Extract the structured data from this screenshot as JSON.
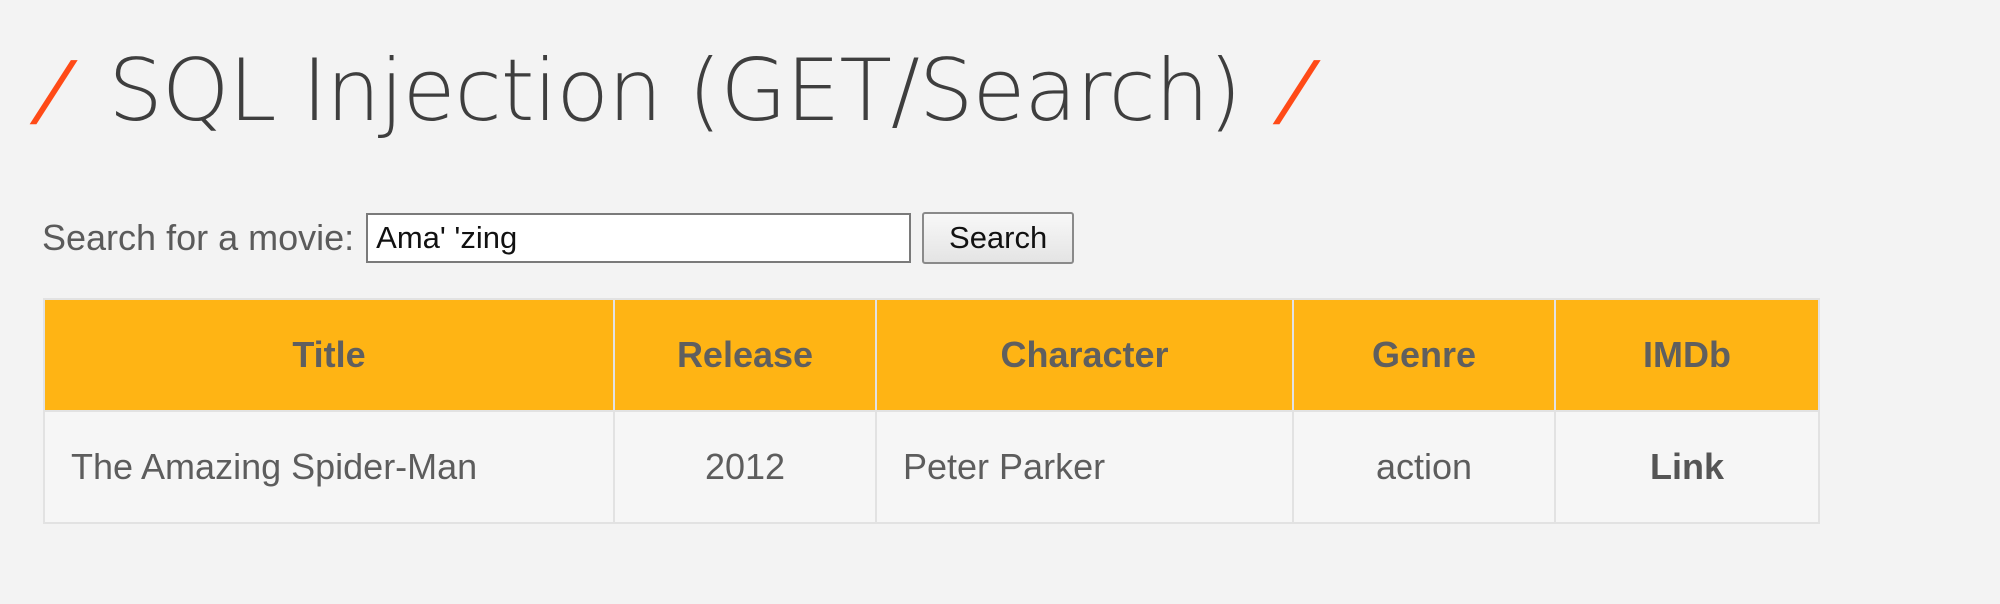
{
  "header": {
    "slash_left": "/",
    "title": "SQL Injection (GET/Search)",
    "slash_right": "/"
  },
  "search": {
    "label": "Search for a movie:",
    "value": "Ama' 'zing",
    "button_label": "Search"
  },
  "table": {
    "headers": {
      "title": "Title",
      "release": "Release",
      "character": "Character",
      "genre": "Genre",
      "imdb": "IMDb"
    },
    "rows": [
      {
        "title": "The Amazing Spider-Man",
        "release": "2012",
        "character": "Peter Parker",
        "genre": "action",
        "imdb": "Link"
      }
    ]
  },
  "colors": {
    "accent_slash": "#ff4a17",
    "table_header": "#ffb414",
    "background": "#f3f3f3"
  }
}
